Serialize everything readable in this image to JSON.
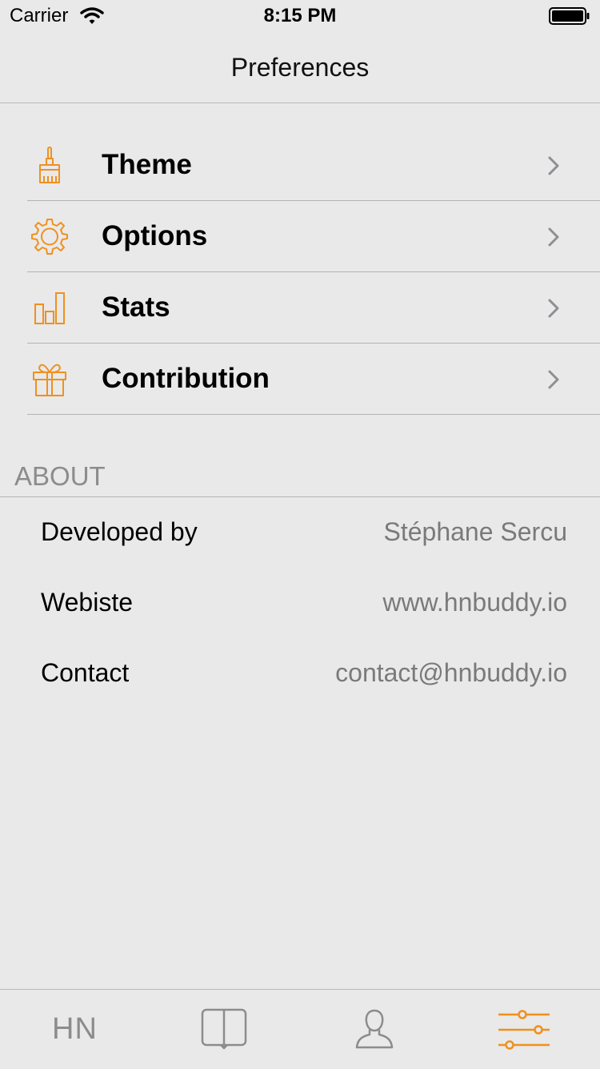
{
  "status_bar": {
    "carrier": "Carrier",
    "time": "8:15 PM"
  },
  "nav": {
    "title": "Preferences"
  },
  "menu": {
    "items": [
      {
        "label": "Theme",
        "icon": "paint-brush-icon"
      },
      {
        "label": "Options",
        "icon": "gear-icon"
      },
      {
        "label": "Stats",
        "icon": "bar-chart-icon"
      },
      {
        "label": "Contribution",
        "icon": "gift-icon"
      }
    ]
  },
  "about": {
    "header": "ABOUT",
    "rows": [
      {
        "key": "Developed by",
        "value": "Stéphane Sercu"
      },
      {
        "key": "Webiste",
        "value": "www.hnbuddy.io"
      },
      {
        "key": "Contact",
        "value": "contact@hnbuddy.io"
      }
    ]
  },
  "tab_bar": {
    "tabs": [
      {
        "label": "HN",
        "icon": "hn-text-icon",
        "active": false
      },
      {
        "label": "",
        "icon": "book-icon",
        "active": false
      },
      {
        "label": "",
        "icon": "person-icon",
        "active": false
      },
      {
        "label": "",
        "icon": "sliders-icon",
        "active": true
      }
    ]
  },
  "colors": {
    "accent": "#f0901e",
    "inactive": "#8c8c8c",
    "background": "#e9e9e9",
    "separator": "#b3b3b3",
    "chevron": "#8e8e93"
  }
}
